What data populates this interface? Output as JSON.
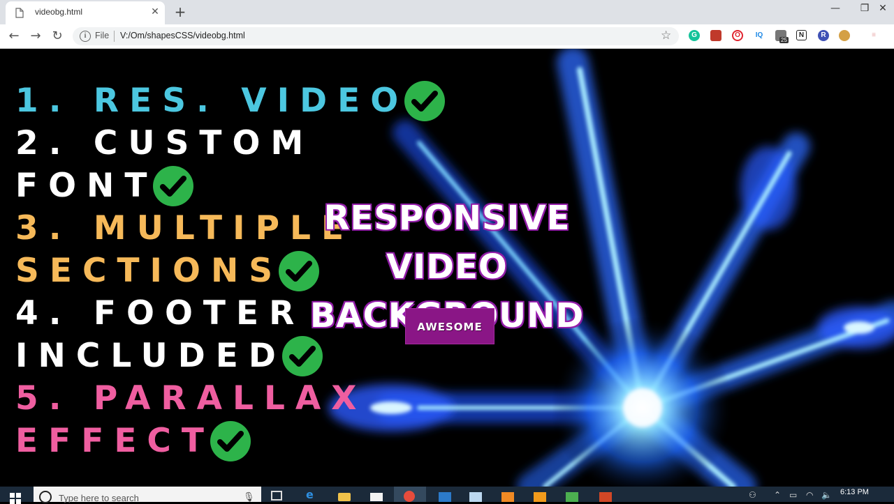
{
  "browser": {
    "tab_title": "videobg.html",
    "tab_close": "✕",
    "new_tab": "+",
    "window_controls": {
      "minimize": "—",
      "maximize": "❐",
      "close": "✕"
    },
    "nav": {
      "back": "←",
      "forward": "→",
      "reload": "↻"
    },
    "omnibox": {
      "scheme_label": "File",
      "url": "V:/Om/shapesCSS/videobg.html",
      "info_icon": "i"
    },
    "bookmark_star": "☆",
    "extensions": [
      {
        "name": "grammarly",
        "label": "G",
        "color": "#15c39a"
      },
      {
        "name": "red-book",
        "label": "",
        "color": "#c0392b"
      },
      {
        "name": "opera",
        "label": "O",
        "color": "#e0242f"
      },
      {
        "name": "iq",
        "label": "IQ",
        "color": "#1e88e5"
      },
      {
        "name": "printer",
        "label": "",
        "color": "#777777"
      },
      {
        "name": "notion",
        "label": "N",
        "color": "#222222"
      },
      {
        "name": "r-ext",
        "label": "R",
        "color": "#3f51b5"
      },
      {
        "name": "cookie",
        "label": "",
        "color": "#d4a045"
      },
      {
        "name": "menu",
        "label": "",
        "color": "#e8a8a8"
      }
    ],
    "extension_badge": "25"
  },
  "features": [
    {
      "text": "1. RES. VIDEO",
      "color": "#4cc7e0",
      "checked": true
    },
    {
      "text": "2. CUSTOM",
      "color": "#ffffff",
      "checked": false
    },
    {
      "text": "FONT",
      "color": "#ffffff",
      "checked": true
    },
    {
      "text": "3. MULTIPLE",
      "color": "#f6b959",
      "checked": false
    },
    {
      "text": "SECTIONS",
      "color": "#f6b959",
      "checked": true
    },
    {
      "text": "4. FOOTER",
      "color": "#ffffff",
      "checked": false
    },
    {
      "text": "INCLUDED",
      "color": "#ffffff",
      "checked": true
    },
    {
      "text": "5. PARALLAX",
      "color": "#ef5ea0",
      "checked": false
    },
    {
      "text": "EFFECT",
      "color": "#ef5ea0",
      "checked": true
    }
  ],
  "hero": {
    "title_line1": "RESPONSIVE VIDEO",
    "title_line2": "BACKGROUND",
    "button_label": "AWESOME",
    "button_color": "#8a1686"
  },
  "taskbar": {
    "search_placeholder": "Type here to search",
    "time": "6:13 PM"
  }
}
